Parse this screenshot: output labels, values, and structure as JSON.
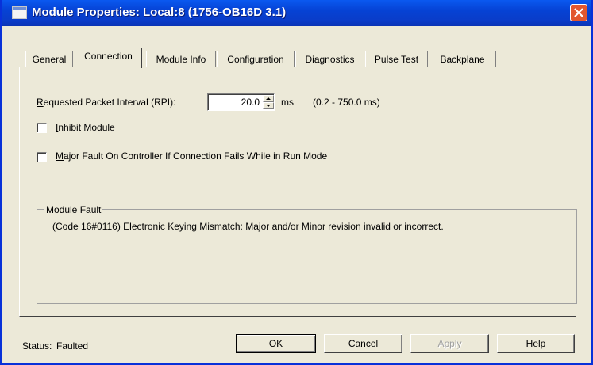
{
  "window": {
    "title": "Module Properties: Local:8 (1756-OB16D 3.1)",
    "title_color": "#ffffff",
    "titlebar_color": "#0a3cc8",
    "close_button_color": "#e2572f"
  },
  "tabs": [
    {
      "label": "General",
      "active": false
    },
    {
      "label": "Connection",
      "active": true
    },
    {
      "label": "Module Info",
      "active": false
    },
    {
      "label": "Configuration",
      "active": false
    },
    {
      "label": "Diagnostics",
      "active": false
    },
    {
      "label": "Pulse Test",
      "active": false
    },
    {
      "label": "Backplane",
      "active": false
    }
  ],
  "connection": {
    "rpi_label": "Requested Packet Interval (RPI):",
    "rpi_value": "20.0",
    "rpi_unit": "ms",
    "rpi_range": "(0.2 - 750.0 ms)",
    "inhibit_label": "Inhibit Module",
    "inhibit_checked": false,
    "major_fault_label": "Major Fault On Controller If Connection Fails While in Run Mode",
    "major_fault_checked": false
  },
  "module_fault": {
    "title": "Module Fault",
    "message": "(Code 16#0116) Electronic Keying Mismatch: Major and/or Minor revision invalid or incorrect."
  },
  "footer": {
    "status_label": "Status:",
    "status_value": "Faulted"
  },
  "buttons": {
    "ok": "OK",
    "cancel": "Cancel",
    "apply": "Apply",
    "help": "Help",
    "apply_enabled": false
  }
}
